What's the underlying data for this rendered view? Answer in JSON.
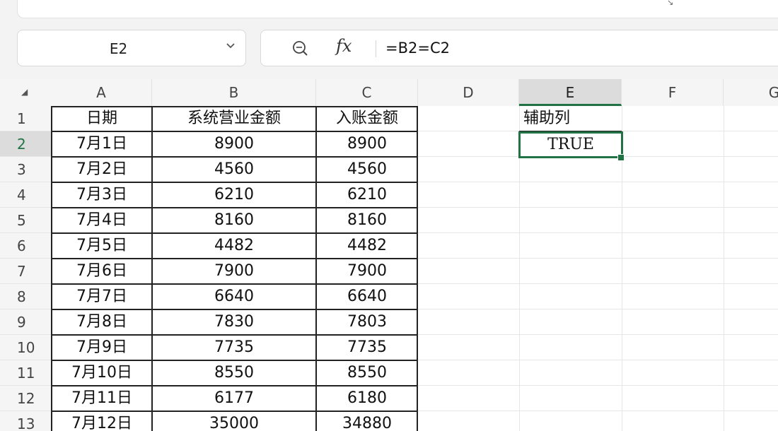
{
  "ribbon": {
    "expand_icon": "dialog-launcher-icon"
  },
  "name_box": {
    "value": "E2",
    "dropdown_icon": "chevron-down-icon"
  },
  "formula_bar": {
    "zoom_icon": "zoom-icon",
    "fx_label": "fx",
    "formula": "=B2=C2"
  },
  "sheet": {
    "columns": [
      "A",
      "B",
      "C",
      "D",
      "E",
      "F",
      "G"
    ],
    "selected_column": "E",
    "rows": [
      "1",
      "2",
      "3",
      "4",
      "5",
      "6",
      "7",
      "8",
      "9",
      "10",
      "11",
      "12",
      "13"
    ],
    "selected_row": "2",
    "headers": {
      "date": "日期",
      "system_amount": "系统营业金额",
      "booked_amount": "入账金额",
      "helper": "辅助列"
    },
    "data": [
      {
        "date": "7月1日",
        "system": "8900",
        "booked": "8900"
      },
      {
        "date": "7月2日",
        "system": "4560",
        "booked": "4560"
      },
      {
        "date": "7月3日",
        "system": "6210",
        "booked": "6210"
      },
      {
        "date": "7月4日",
        "system": "8160",
        "booked": "8160"
      },
      {
        "date": "7月5日",
        "system": "4482",
        "booked": "4482"
      },
      {
        "date": "7月6日",
        "system": "7900",
        "booked": "7900"
      },
      {
        "date": "7月7日",
        "system": "6640",
        "booked": "6640"
      },
      {
        "date": "7月8日",
        "system": "7830",
        "booked": "7803"
      },
      {
        "date": "7月9日",
        "system": "7735",
        "booked": "7735"
      },
      {
        "date": "7月10日",
        "system": "8550",
        "booked": "8550"
      },
      {
        "date": "7月11日",
        "system": "6177",
        "booked": "6180"
      },
      {
        "date": "7月12日",
        "system": "35000",
        "booked": "34880"
      }
    ],
    "helper_values": [
      "TRUE"
    ],
    "accent_color": "#217346"
  }
}
